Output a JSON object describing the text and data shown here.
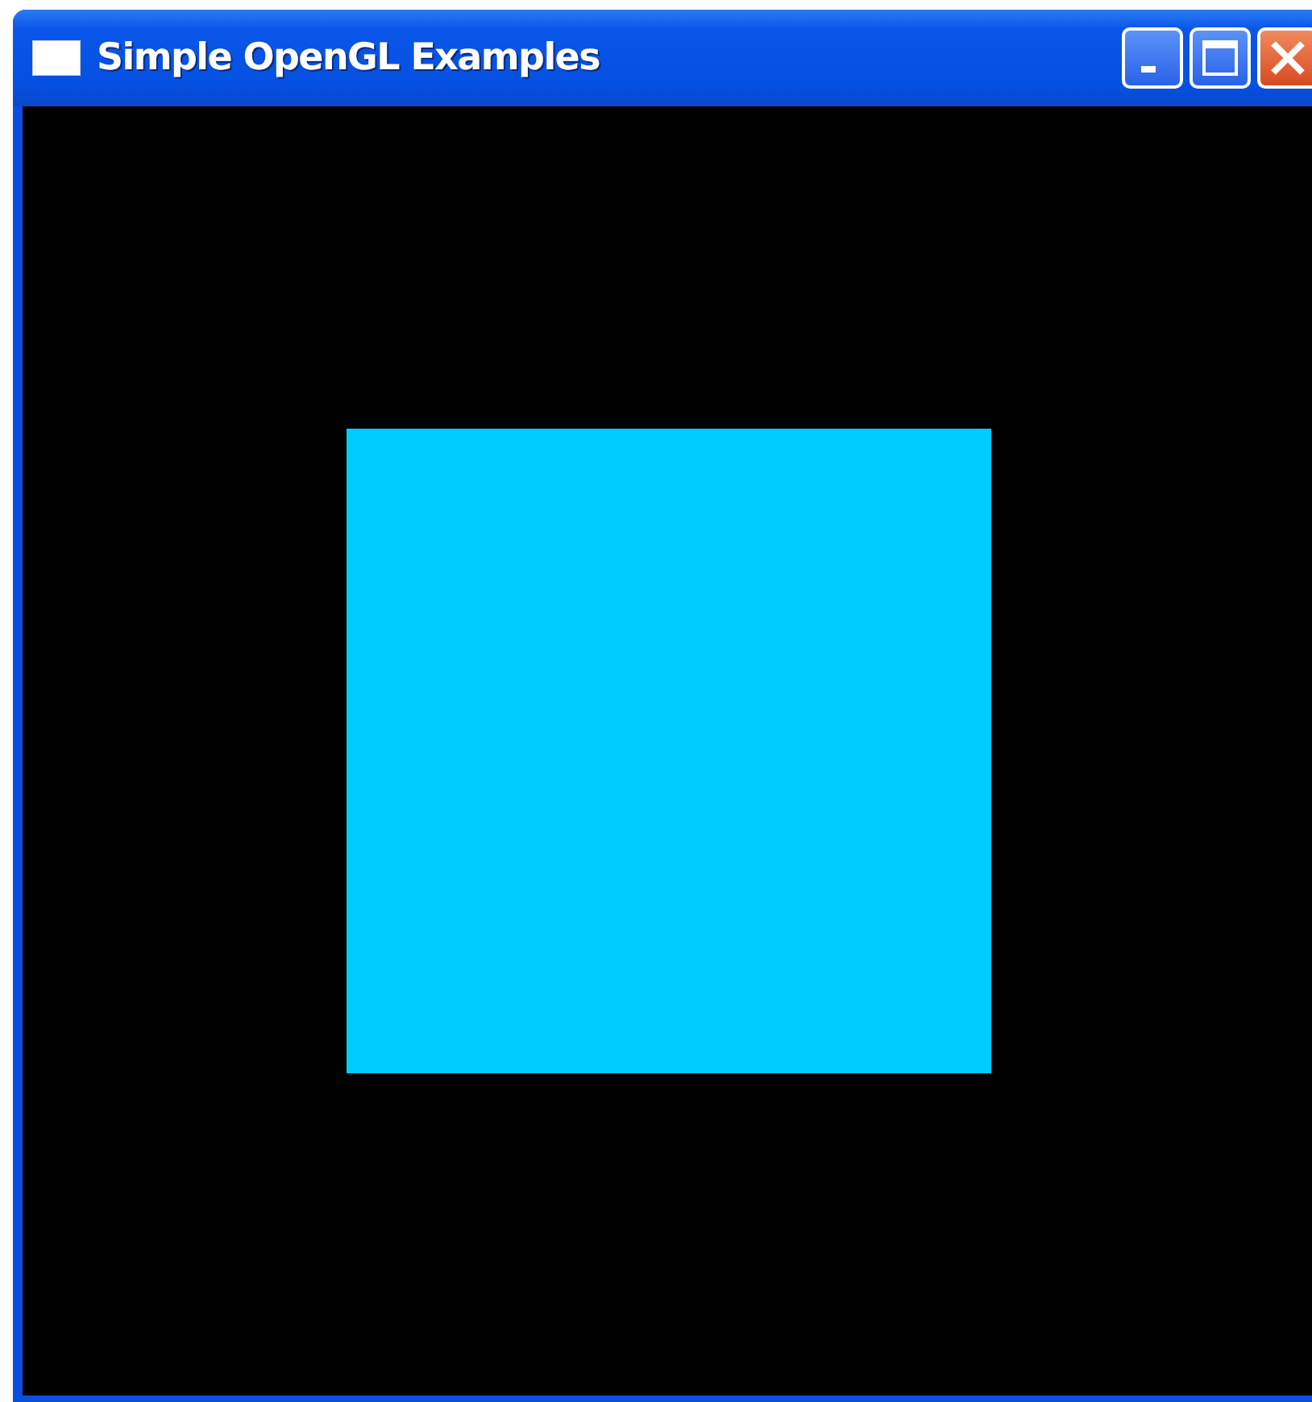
{
  "window": {
    "title": "Simple OpenGL Examples"
  }
}
